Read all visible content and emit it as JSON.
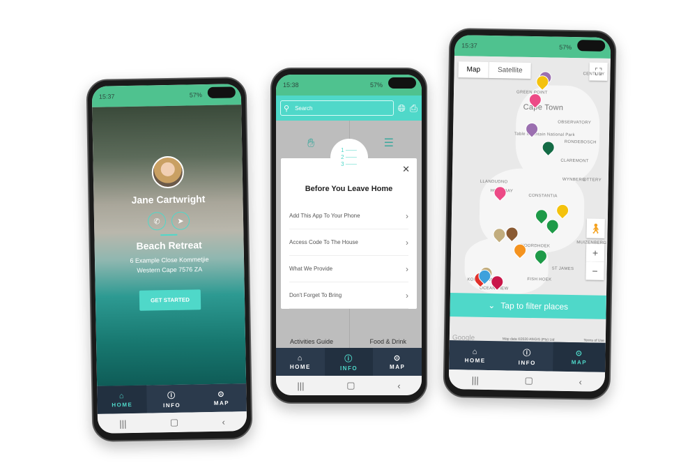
{
  "nav": {
    "home": "HOME",
    "info": "INFO",
    "map": "MAP"
  },
  "phone1": {
    "time": "15:37",
    "battery": "57%",
    "host_name": "Jane Cartwright",
    "property": "Beach Retreat",
    "address_line1": "6 Example Close Kommetjie",
    "address_line2": "Western Cape 7576 ZA",
    "cta": "GET STARTED"
  },
  "phone2": {
    "time": "15:38",
    "battery": "57%",
    "search_placeholder": "Search",
    "grid": [
      "Activities Guide",
      "Food & Drink"
    ],
    "modal": {
      "title": "Before You Leave Home",
      "items": [
        "Add This App To Your Phone",
        "Access Code To The House",
        "What We Provide",
        "Don't Forget To Bring"
      ]
    }
  },
  "phone3": {
    "time": "15:37",
    "battery": "57%",
    "map_tab": "Map",
    "satellite_tab": "Satellite",
    "labels": [
      "CENTURY",
      "GREEN POINT",
      "Cape Town",
      "OBSERVATORY",
      "Table Mountain National Park",
      "RONDEBOSCH",
      "CLAREMONT",
      "WYNBERG",
      "OTTERY",
      "LLANDUDNO",
      "HOUT BAY",
      "CONSTANTIA",
      "MUIZENBERG",
      "NOORDHOEK",
      "ST JAMES",
      "FISH HOEK",
      "KOMMETJIE",
      "OCEAN VIEW"
    ],
    "google": "Google",
    "map_data": "Map data ©2020 AfriGIS (Pty) Ltd",
    "terms": "Terms of Use",
    "filter": "Tap to filter places",
    "pins": [
      {
        "color": "#9b6fb0"
      },
      {
        "color": "#f4c20d"
      },
      {
        "color": "#ec4a86"
      },
      {
        "color": "#9b6fb0"
      },
      {
        "color": "#146b45"
      },
      {
        "color": "#ec4a86"
      },
      {
        "color": "#1e9a48"
      },
      {
        "color": "#f4c20d"
      },
      {
        "color": "#1e9a48"
      },
      {
        "color": "#c2ad7e"
      },
      {
        "color": "#8a5a32"
      },
      {
        "color": "#f4931f"
      },
      {
        "color": "#1e9a48"
      },
      {
        "color": "#c2ad7e"
      },
      {
        "color": "#e0312b"
      },
      {
        "color": "#3ea1dc"
      },
      {
        "color": "#c9174a"
      }
    ]
  },
  "colors": {
    "accent": "#4fd8c9",
    "status": "#4fc28f",
    "nav": "#2b3a4c"
  }
}
